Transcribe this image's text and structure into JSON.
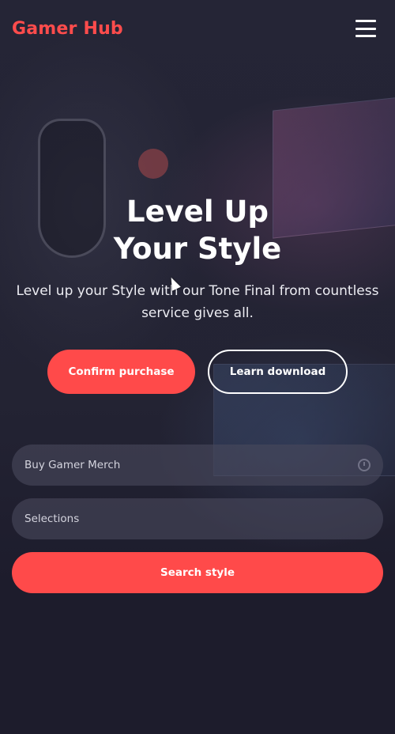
{
  "header": {
    "logo": "Gamer Hub",
    "menu_icon": "hamburger-menu-icon"
  },
  "hero": {
    "title_line1": "Level Up",
    "title_line2": "Your Style",
    "subtitle": "Level up your Style with our Tone Final from countless service gives all."
  },
  "actions": {
    "primary_label": "Confirm purchase",
    "secondary_label": "Learn download"
  },
  "search_form": {
    "field1_placeholder": "Buy Gamer Merch",
    "field1_icon": "clock-icon",
    "field2_placeholder": "Selections",
    "submit_label": "Search style"
  },
  "colors": {
    "accent": "#ff4a4a",
    "background": "#1e1d2e",
    "field_bg": "#48485c"
  }
}
